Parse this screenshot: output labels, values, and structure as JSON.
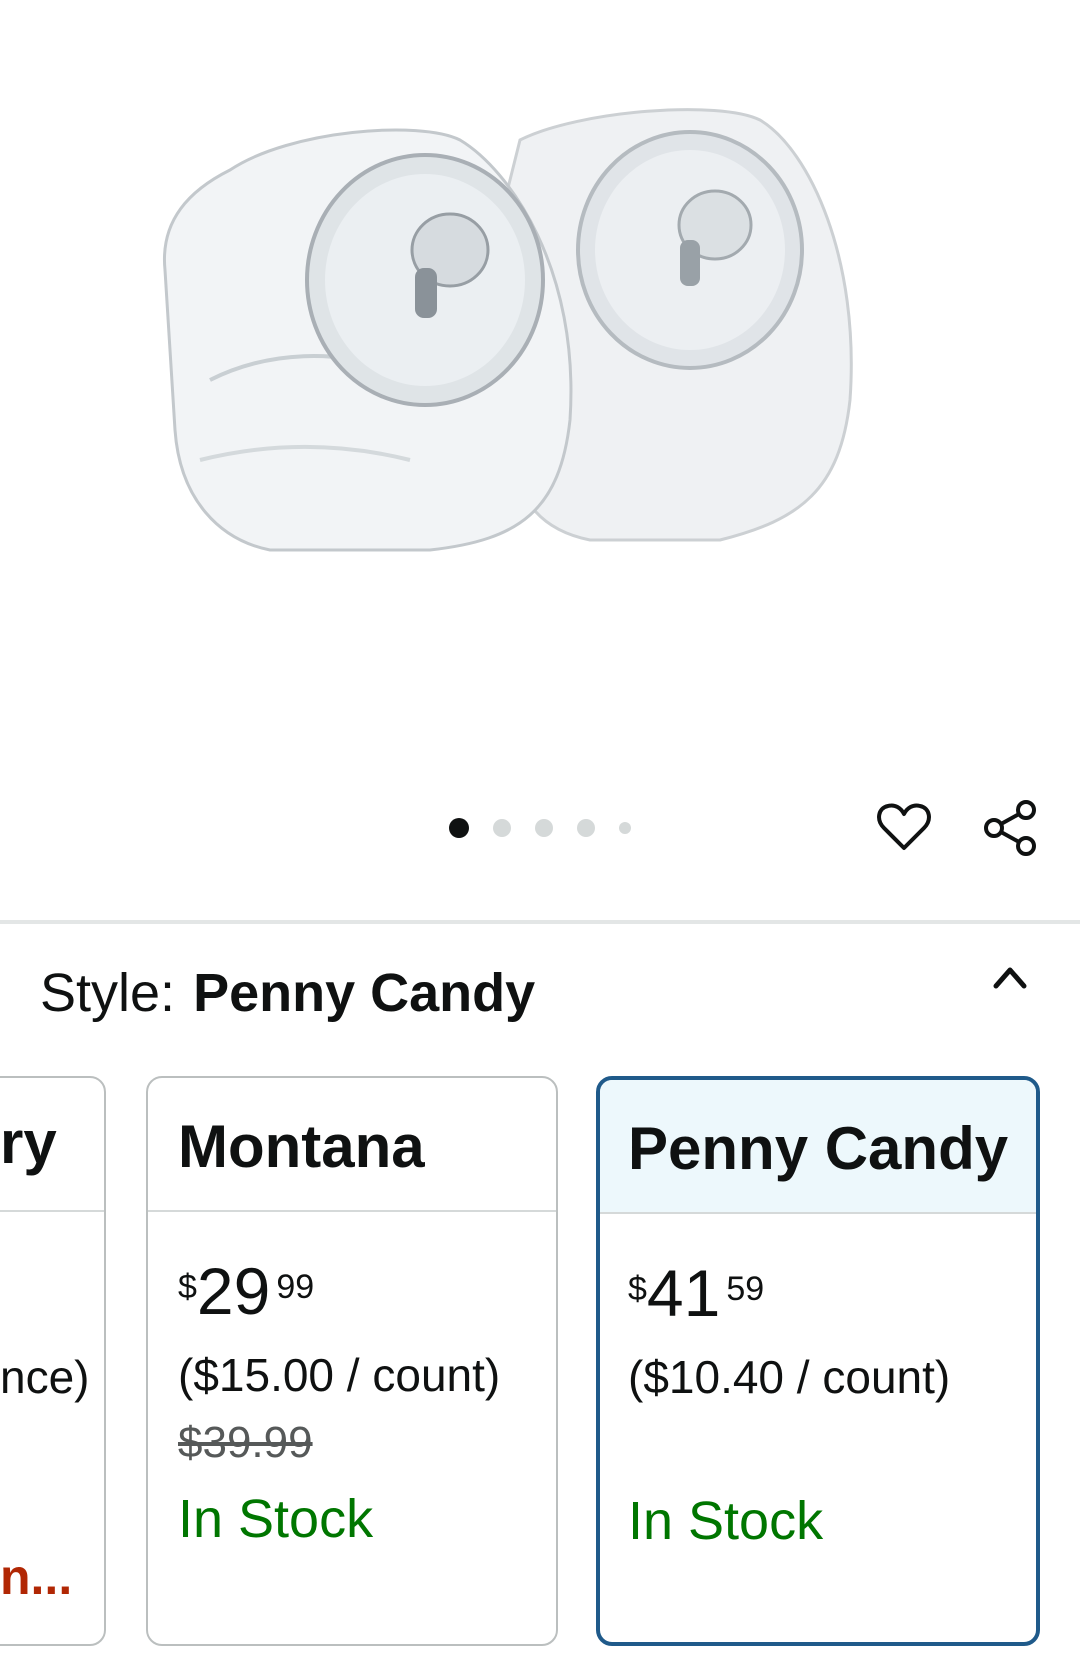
{
  "gallery": {
    "image_alt": "Two glass penny candy jars with chrome lids",
    "dot_count": 5,
    "active_index": 0
  },
  "actions": {
    "wishlist_icon": "heart-icon",
    "share_icon": "share-icon"
  },
  "style_selector": {
    "label": "Style:",
    "value": "Penny Candy",
    "collapse_icon": "chevron-up-icon",
    "options": [
      {
        "name": "ry",
        "unit_price": "nce)",
        "note": "n..."
      },
      {
        "name": "Montana",
        "currency": "$",
        "whole": "29",
        "fraction": "99",
        "unit_price": "($15.00 / count)",
        "list_price": "$39.99",
        "availability": "In Stock"
      },
      {
        "name": "Penny Candy",
        "currency": "$",
        "whole": "41",
        "fraction": "59",
        "unit_price": "($10.40 / count)",
        "availability": "In Stock",
        "selected": true
      }
    ]
  },
  "colors": {
    "in_stock": "#007600",
    "selected_border": "#1f5a8a",
    "selected_header_bg": "#edf8fc",
    "deal_text": "#b12704"
  }
}
